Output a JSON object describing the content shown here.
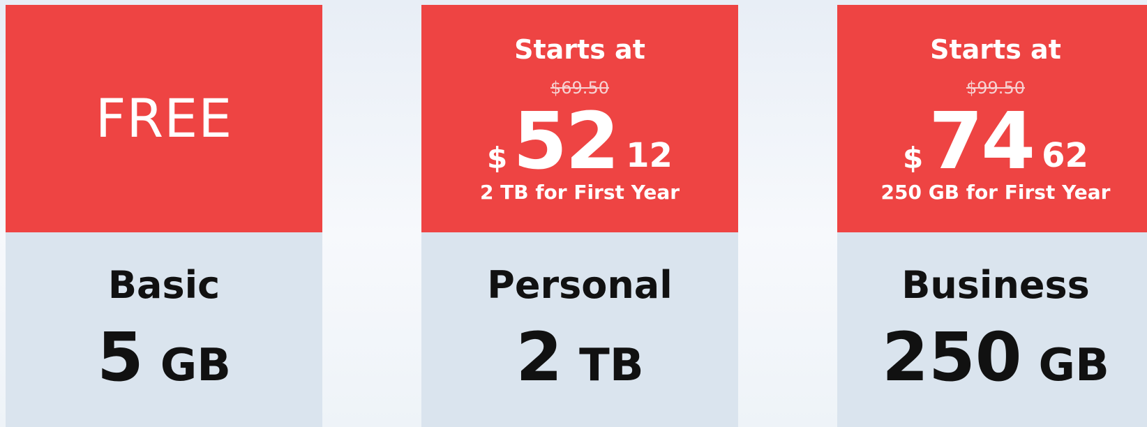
{
  "colors": {
    "price_background": "#ee4443",
    "plan_background": "#dae4ee",
    "text_light": "#ffffff",
    "text_dark": "#111111"
  },
  "plans": [
    {
      "price": {
        "free_label": "FREE"
      },
      "name": "Basic",
      "storage": {
        "amount": "5",
        "unit": "GB"
      }
    },
    {
      "price": {
        "starts_label": "Starts at",
        "old_price": "$69.50",
        "currency": "$",
        "whole": "52",
        "cents": "12",
        "term": "2 TB for First Year"
      },
      "name": "Personal",
      "storage": {
        "amount": "2",
        "unit": "TB"
      }
    },
    {
      "price": {
        "starts_label": "Starts at",
        "old_price": "$99.50",
        "currency": "$",
        "whole": "74",
        "cents": "62",
        "term": "250 GB for First Year"
      },
      "name": "Business",
      "storage": {
        "amount": "250",
        "unit": "GB"
      }
    }
  ]
}
